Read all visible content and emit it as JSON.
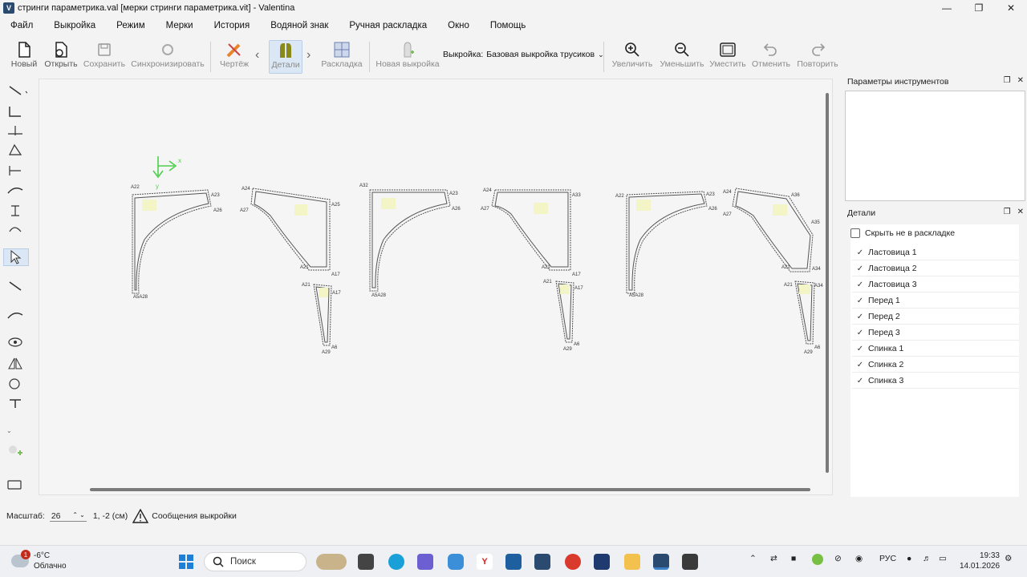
{
  "window": {
    "title": "стринги параметрика.val [мерки стринги параметрика.vit] - Valentina",
    "app_icon": "V",
    "controls": [
      "minimize-icon",
      "maximize-icon",
      "close-icon"
    ]
  },
  "menu": [
    "Файл",
    "Выкройка",
    "Режим",
    "Мерки",
    "История",
    "Водяной знак",
    "Ручная раскладка",
    "Окно",
    "Помощь"
  ],
  "toolbar": {
    "new": "Новый",
    "open": "Открыть",
    "save": "Сохранить",
    "sync": "Синхронизировать",
    "draft": "Чертёж",
    "details": "Детали",
    "layout": "Раскладка",
    "new_pattern": "Новая выкройка",
    "pattern_label": "Выкройка:",
    "pattern_value": "Базовая выкройка трусиков",
    "zoom_in": "Увеличить",
    "zoom_out": "Уменьшить",
    "fit": "Уместить",
    "undo": "Отменить",
    "redo": "Повторить"
  },
  "status": {
    "scale_label": "Масштаб:",
    "scale_value": "26",
    "coords": "1, -2 (см)",
    "messages": "Сообщения выкройки"
  },
  "panels": {
    "tool_params_title": "Параметры инструментов",
    "details_title": "Детали",
    "hide_not_in_layout": "Скрыть не в раскладке",
    "details": [
      "Ластовица 1",
      "Ластовица 2",
      "Ластовица 3",
      "Перед 1",
      "Перед 2",
      "Перед 3",
      "Спинка 1",
      "Спинка 2",
      "Спинка 3"
    ]
  },
  "canvas": {
    "axis_x": "x",
    "axis_y": "y",
    "points": [
      "A22",
      "A23",
      "A26",
      "A5A28",
      "A24",
      "A25",
      "A27",
      "A21",
      "A17",
      "A32",
      "A33",
      "A29",
      "A6",
      "A36",
      "A35",
      "A34"
    ]
  },
  "taskbar": {
    "weather_temp": "-6°C",
    "weather_desc": "Облачно",
    "weather_badge": "1",
    "search": "Поиск",
    "lang": "РУС",
    "time": "19:33",
    "date": "14.01.2026"
  }
}
